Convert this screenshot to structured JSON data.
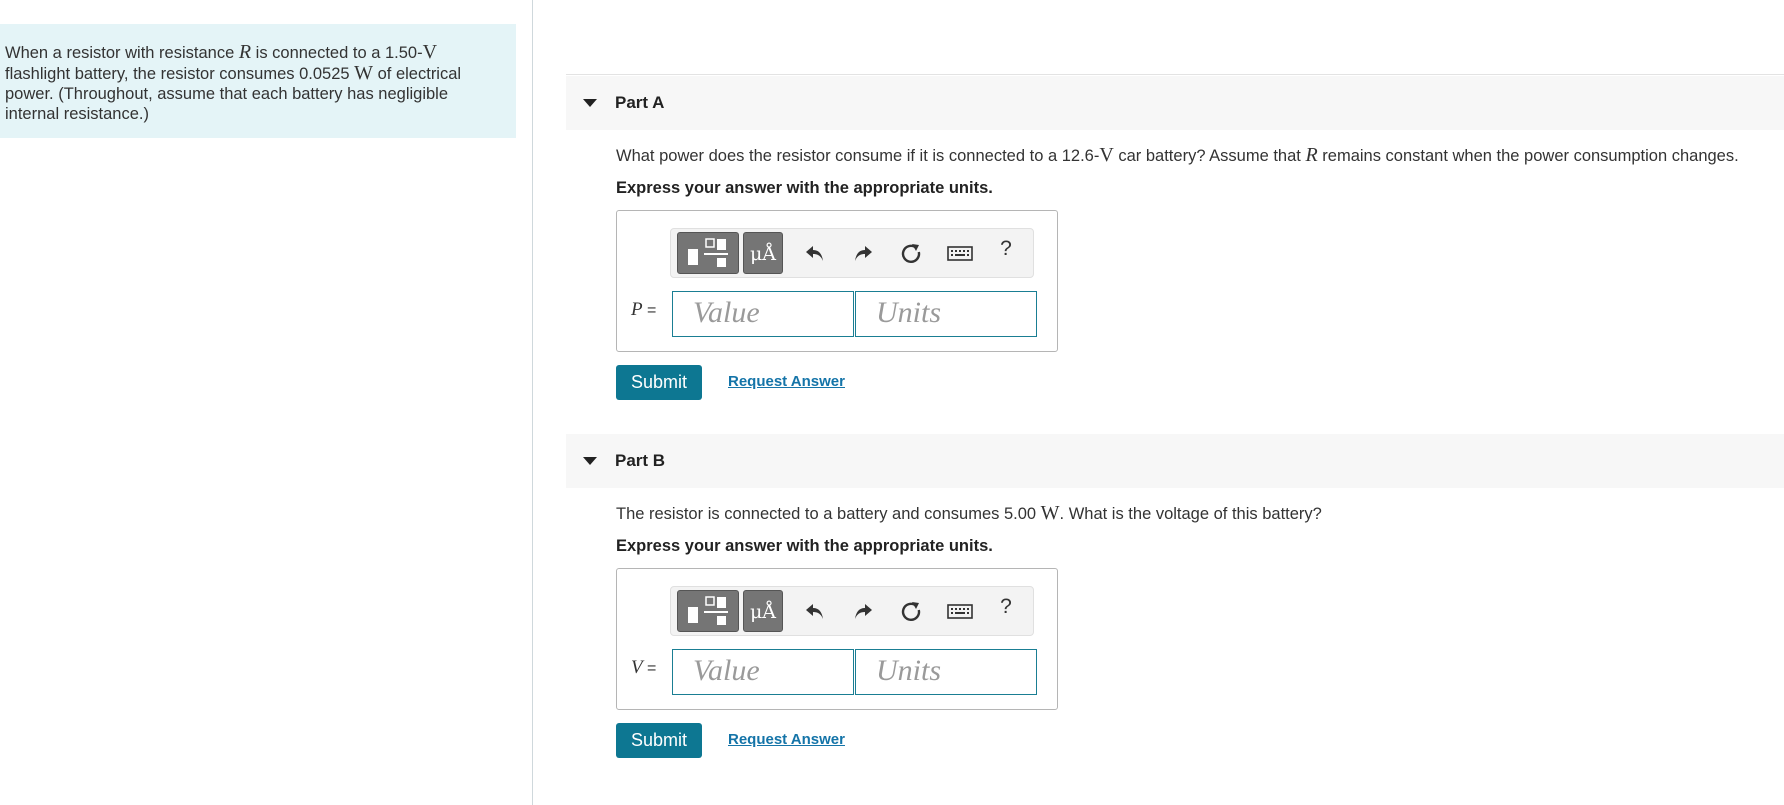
{
  "problem": {
    "t1": "When a resistor with resistance ",
    "R": "R",
    "t2": " is connected to a 1.50-",
    "V": "V",
    "t3": "flashlight battery, the resistor consumes 0.0525 ",
    "W": "W",
    "t4": " of electrical power. (Throughout, assume that each battery has negligible internal resistance.)"
  },
  "parts": [
    {
      "title": "Part A",
      "q1": "What power does the resistor consume if it is connected to a 12.6-",
      "qV": "V",
      "q2": " car battery? Assume that ",
      "qR": "R",
      "q3": " remains constant when the power consumption changes.",
      "instruction": "Express your answer with the appropriate units.",
      "variable": "P",
      "eq": " =",
      "value_placeholder": "Value",
      "units_placeholder": "Units",
      "submit": "Submit",
      "request": "Request Answer"
    },
    {
      "title": "Part B",
      "q1": "The resistor is connected to a battery and consumes 5.00 ",
      "qW": "W",
      "q2": ". What is the voltage of this battery?",
      "instruction": "Express your answer with the appropriate units.",
      "variable": "V",
      "eq": " =",
      "value_placeholder": "Value",
      "units_placeholder": "Units",
      "submit": "Submit",
      "request": "Request Answer"
    }
  ],
  "toolbar": {
    "mu_label": "μÅ",
    "help": "?",
    "icons": [
      "templates-icon",
      "units-icon",
      "undo-icon",
      "redo-icon",
      "reset-icon",
      "keyboard-icon",
      "help-icon"
    ]
  },
  "colors": {
    "accent": "#0d7792",
    "panel": "#e4f4f7",
    "field_border": "#1a7e93",
    "link": "#1474a8"
  }
}
